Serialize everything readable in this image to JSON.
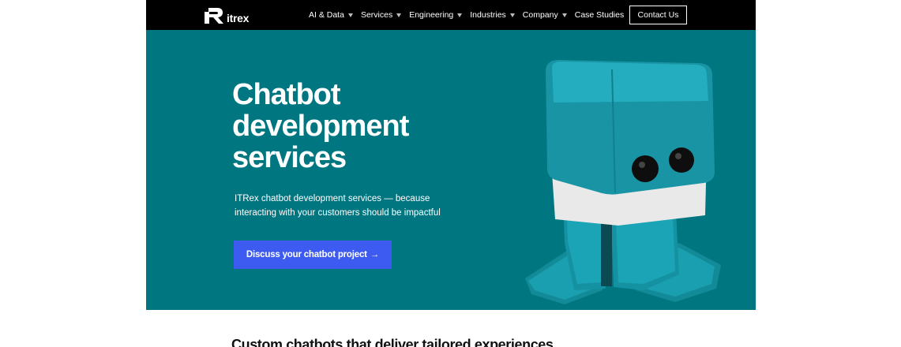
{
  "header": {
    "logo_text": "itrex",
    "nav": [
      {
        "label": "AI & Data",
        "has_dropdown": true
      },
      {
        "label": "Services",
        "has_dropdown": true
      },
      {
        "label": "Engineering",
        "has_dropdown": true
      },
      {
        "label": "Industries",
        "has_dropdown": true
      },
      {
        "label": "Company",
        "has_dropdown": true
      },
      {
        "label": "Case Studies",
        "has_dropdown": false
      }
    ],
    "contact_label": "Contact Us"
  },
  "hero": {
    "title_line1": "Chatbot",
    "title_line2": "development",
    "title_line3": "services",
    "subtitle_line1": "ITRex chatbot development services — because",
    "subtitle_line2": "interacting with your customers should be impactful",
    "cta_label": "Discuss your chatbot project",
    "cta_arrow": "→"
  },
  "section": {
    "heading": "Custom chatbots that deliver tailored experiences"
  },
  "colors": {
    "nav_bg": "#000000",
    "hero_bg": "#007680",
    "cta_bg": "#3d5bf0",
    "robot_body": "#1a9fb0",
    "robot_band": "#f2f2f2"
  }
}
